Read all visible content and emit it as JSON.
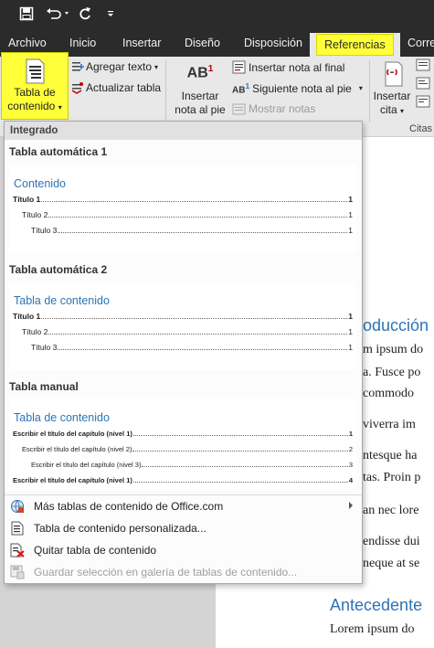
{
  "qat": {
    "icons": [
      "save-icon",
      "undo-icon",
      "redo-icon",
      "customize-qat-icon"
    ]
  },
  "tabs": [
    "Archivo",
    "Inicio",
    "Insertar",
    "Diseño",
    "Disposición",
    "Referencias",
    "Corre"
  ],
  "active_tab": "Referencias",
  "ribbon": {
    "toc_button": {
      "line1": "Tabla de",
      "line2": "contenido"
    },
    "add_text": "Agregar texto",
    "update_table": "Actualizar tabla",
    "insert_footnote": {
      "line1": "Insertar",
      "line2": "nota al pie"
    },
    "insert_endnote": "Insertar nota al final",
    "next_footnote": "Siguiente nota al pie",
    "show_notes": "Mostrar notas",
    "insert_citation": {
      "line1": "Insertar",
      "line2": "cita"
    },
    "citations_group": "Citas",
    "highlight_color": "#ffff3a"
  },
  "dropdown": {
    "section_header": "Integrado",
    "templates": [
      {
        "name": "Tabla automática 1",
        "preview_title": "Contenido",
        "entries": [
          {
            "text": "Título 1",
            "page": "1",
            "level": 1
          },
          {
            "text": "Título 2",
            "page": "1",
            "level": 2
          },
          {
            "text": "Título 3",
            "page": "1",
            "level": 3
          }
        ]
      },
      {
        "name": "Tabla automática 2",
        "preview_title": "Tabla de contenido",
        "entries": [
          {
            "text": "Título 1",
            "page": "1",
            "level": 1
          },
          {
            "text": "Título 2",
            "page": "1",
            "level": 2
          },
          {
            "text": "Título 3",
            "page": "1",
            "level": 3
          }
        ]
      },
      {
        "name": "Tabla manual",
        "preview_title": "Tabla de contenido",
        "entries": [
          {
            "text": "Escribir el título del capítulo (nivel 1)",
            "page": "1",
            "level": 1
          },
          {
            "text": "Escribir el título del capítulo (nivel 2)",
            "page": "2",
            "level": 2
          },
          {
            "text": "Escribir el título del capítulo (nivel 3)",
            "page": "3",
            "level": 3
          },
          {
            "text": "Escribir el título del capítulo (nivel 1)",
            "page": "4",
            "level": 1
          }
        ]
      }
    ],
    "menu": [
      {
        "label": "Más tablas de contenido de Office.com",
        "icon": "office-globe-icon",
        "submenu": true,
        "enabled": true
      },
      {
        "label": "Tabla de contenido personalizada...",
        "icon": "toc-page-icon",
        "submenu": false,
        "enabled": true
      },
      {
        "label": "Quitar tabla de contenido",
        "icon": "remove-toc-icon",
        "submenu": false,
        "enabled": true
      },
      {
        "label": "Guardar selección en galería de tablas de contenido...",
        "icon": "save-gallery-icon",
        "submenu": false,
        "enabled": false
      }
    ]
  },
  "document": {
    "heading1": "oducción",
    "lines": [
      "m ipsum do",
      "a. Fusce po",
      "commodo",
      "viverra im",
      "ntesque ha",
      "tas. Proin p",
      "an nec lore",
      "endisse dui",
      "neque at se"
    ],
    "heading2": "Antecedente",
    "last_line": "Lorem ipsum do"
  }
}
